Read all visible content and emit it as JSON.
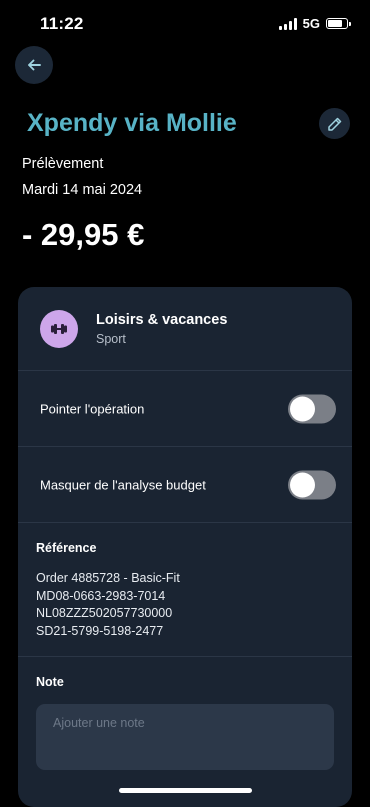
{
  "status_bar": {
    "time": "11:22",
    "network": "5G",
    "battery_level": 0.8
  },
  "header": {
    "back_icon": "arrow-left-icon",
    "merchant": "Xpendy via Mollie",
    "edit_icon": "pencil-icon"
  },
  "transaction": {
    "type": "Prélèvement",
    "date": "Mardi 14 mai 2024",
    "amount": "- 29,95 €"
  },
  "category": {
    "icon": "dumbbell-icon",
    "name": "Loisirs & vacances",
    "subcategory": "Sport"
  },
  "toggles": [
    {
      "label": "Pointer l'opération",
      "on": false
    },
    {
      "label": "Masquer de l'analyse budget",
      "on": false
    }
  ],
  "reference": {
    "title": "Référence",
    "lines": [
      "Order 4885728 - Basic-Fit",
      "MD08-0663-2983-7014",
      "NL08ZZZ502057730000",
      "SD21-5799-5198-2477"
    ]
  },
  "note": {
    "title": "Note",
    "placeholder": "Ajouter une note",
    "value": ""
  },
  "colors": {
    "background": "#000000",
    "accent": "#58b3c6",
    "card": "#1a2432",
    "category_icon_bg": "#cda6ea",
    "toggle_off": "#7b7f87"
  }
}
